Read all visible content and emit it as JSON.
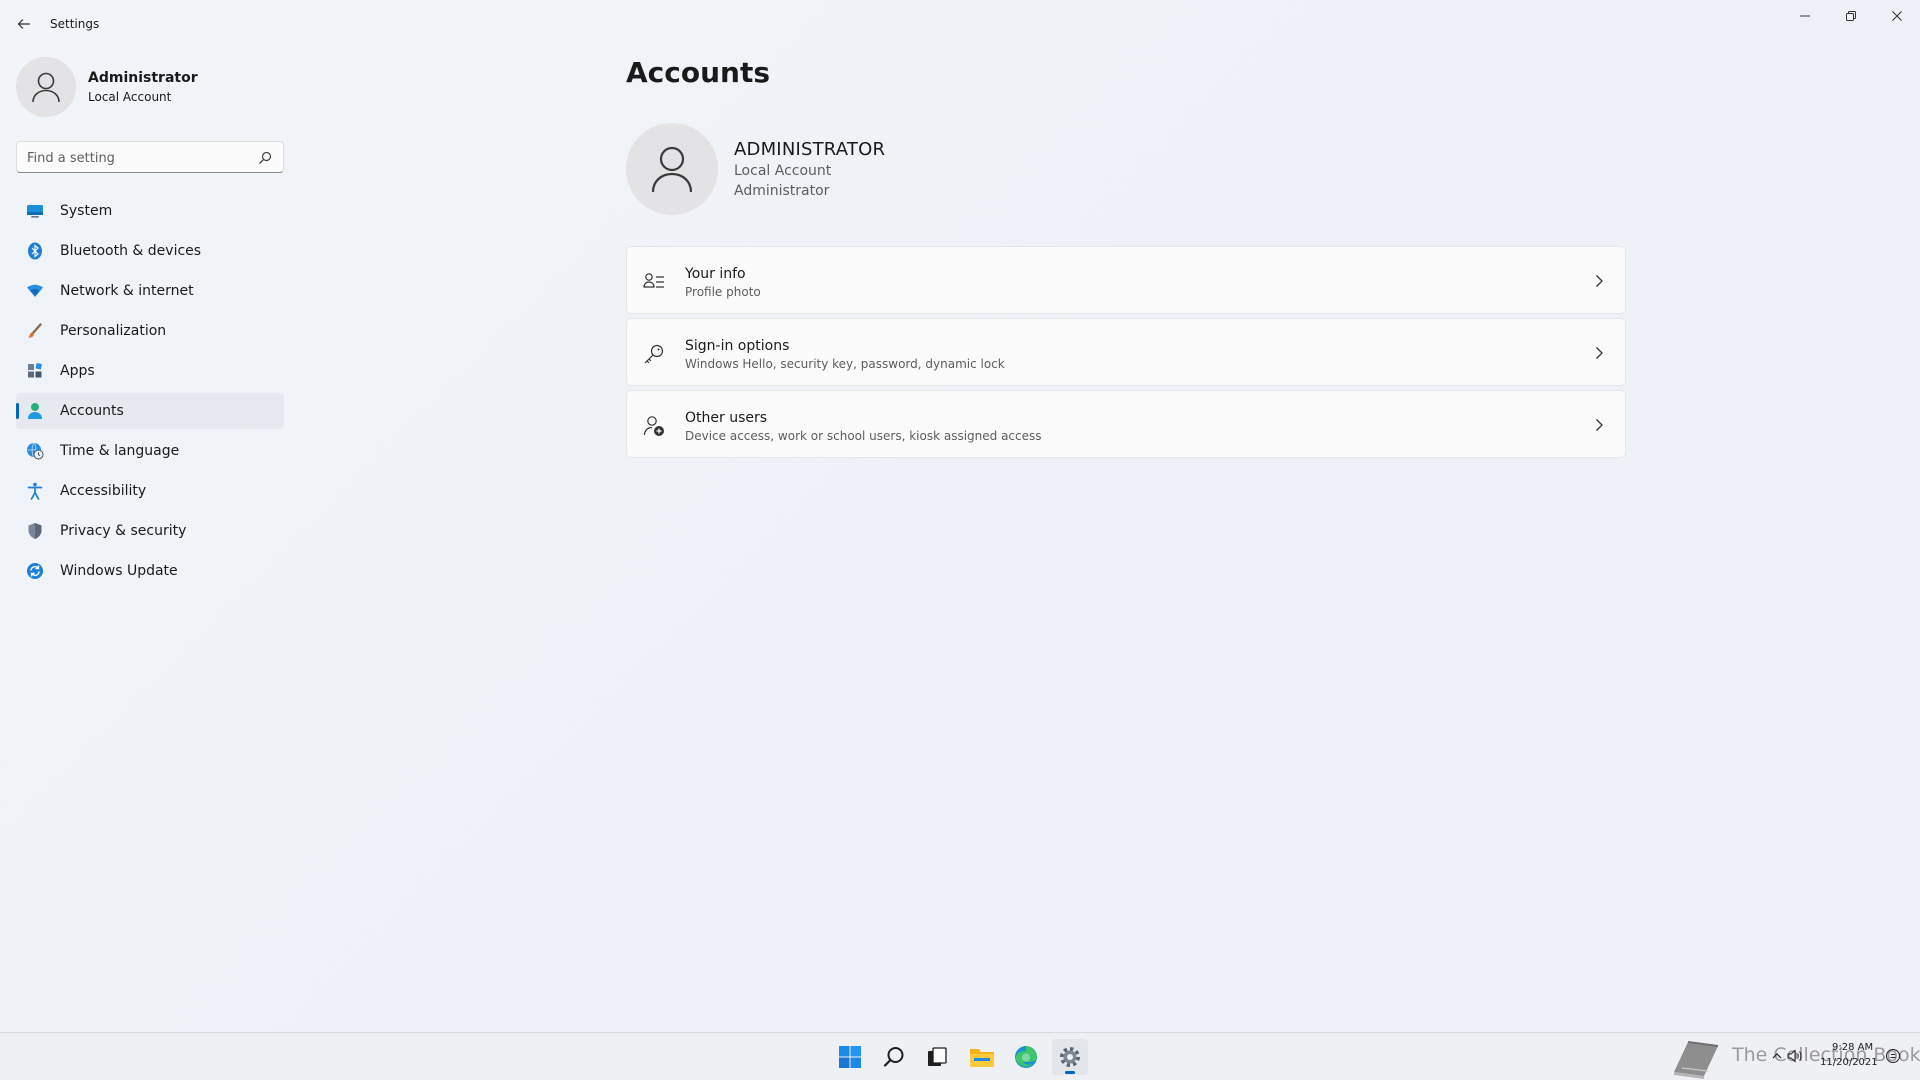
{
  "window": {
    "title": "Settings",
    "controls": [
      "minimize",
      "restore",
      "close"
    ]
  },
  "profile": {
    "name": "Administrator",
    "account_type": "Local Account"
  },
  "search": {
    "placeholder": "Find a setting",
    "value": ""
  },
  "nav": {
    "selected": "Accounts",
    "items": [
      {
        "label": "System",
        "icon": "system-icon"
      },
      {
        "label": "Bluetooth & devices",
        "icon": "bluetooth-icon"
      },
      {
        "label": "Network & internet",
        "icon": "network-icon"
      },
      {
        "label": "Personalization",
        "icon": "brush-icon"
      },
      {
        "label": "Apps",
        "icon": "apps-icon"
      },
      {
        "label": "Accounts",
        "icon": "accounts-icon"
      },
      {
        "label": "Time & language",
        "icon": "globe-clock-icon"
      },
      {
        "label": "Accessibility",
        "icon": "accessibility-icon"
      },
      {
        "label": "Privacy & security",
        "icon": "shield-icon"
      },
      {
        "label": "Windows Update",
        "icon": "update-icon"
      }
    ]
  },
  "main": {
    "title": "Accounts",
    "user": {
      "name": "ADMINISTRATOR",
      "account_type": "Local Account",
      "role": "Administrator"
    },
    "cards": [
      {
        "title": "Your info",
        "subtitle": "Profile photo",
        "icon": "person-info-icon"
      },
      {
        "title": "Sign-in options",
        "subtitle": "Windows Hello, security key, password, dynamic lock",
        "icon": "key-icon"
      },
      {
        "title": "Other users",
        "subtitle": "Device access, work or school users, kiosk assigned access",
        "icon": "add-person-icon"
      }
    ]
  },
  "taskbar": {
    "apps": [
      "start-icon",
      "search-icon",
      "task-view-icon",
      "file-explorer-icon",
      "edge-icon",
      "settings-icon"
    ],
    "active_app": "settings-icon",
    "watermark": "The Collection Book",
    "clock": {
      "time": "9:28 AM",
      "date": "11/20/2021"
    }
  },
  "colors": {
    "accent": "#0067c0",
    "background": "#f1f4f9",
    "card": "#fbfbfc"
  }
}
